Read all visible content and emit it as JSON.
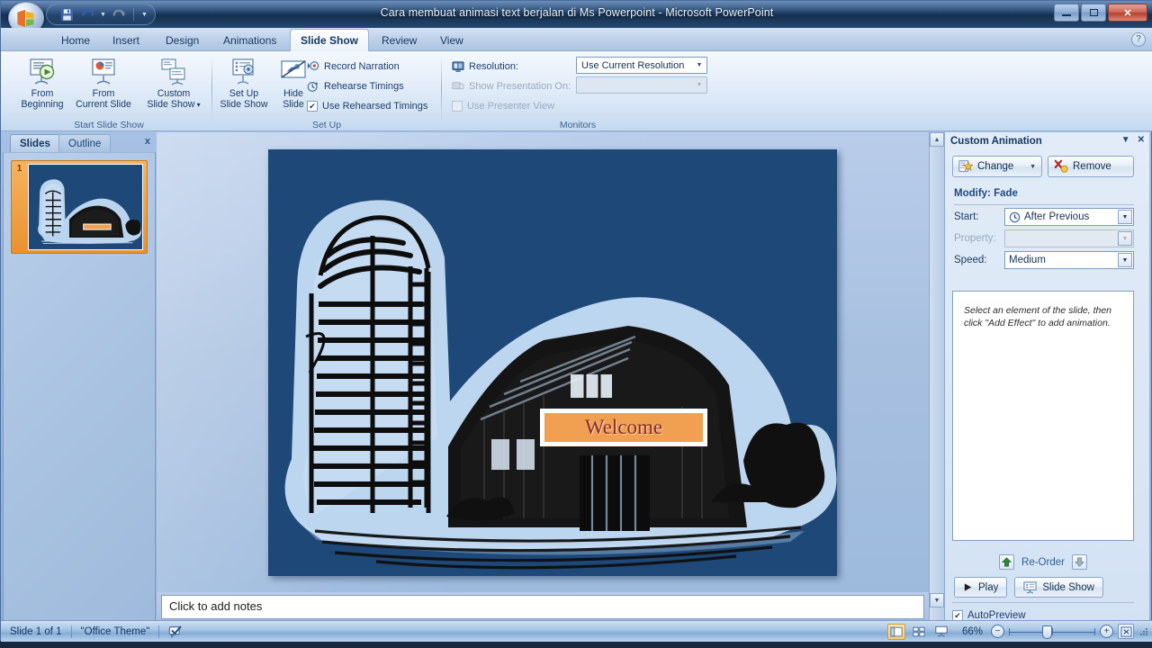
{
  "window": {
    "title": "Cara membuat animasi text berjalan di Ms Powerpoint - Microsoft PowerPoint",
    "minimize_label": "Minimize",
    "restore_label": "Restore Down",
    "close_label": "Close"
  },
  "quick_access": {
    "save_label": "Save",
    "undo_label": "Undo",
    "redo_label": "Redo",
    "customize_label": "Customize Quick Access Toolbar"
  },
  "ribbon": {
    "tabs": [
      {
        "label": "Home",
        "active": false
      },
      {
        "label": "Insert",
        "active": false
      },
      {
        "label": "Design",
        "active": false
      },
      {
        "label": "Animations",
        "active": false
      },
      {
        "label": "Slide Show",
        "active": true
      },
      {
        "label": "Review",
        "active": false
      },
      {
        "label": "View",
        "active": false
      }
    ],
    "help_label": "?",
    "groups": [
      {
        "name": "Start Slide Show",
        "label": "Start Slide Show"
      },
      {
        "name": "Set Up",
        "label": "Set Up"
      },
      {
        "name": "Monitors",
        "label": "Monitors"
      }
    ],
    "start_slide_show": {
      "from_beginning": {
        "line1": "From",
        "line2": "Beginning"
      },
      "from_current": {
        "line1": "From",
        "line2": "Current Slide"
      },
      "custom_slide_show": {
        "line1": "Custom",
        "line2": "Slide Show"
      }
    },
    "set_up": {
      "set_up_slide_show": {
        "line1": "Set Up",
        "line2": "Slide Show"
      },
      "hide_slide": {
        "line1": "Hide",
        "line2": "Slide"
      },
      "record_narration": "Record Narration",
      "rehearse_timings": "Rehearse Timings",
      "use_rehearsed_timings": "Use Rehearsed Timings",
      "use_rehearsed_checked": "✔"
    },
    "monitors": {
      "resolution_label": "Resolution:",
      "resolution_value": "Use Current Resolution",
      "show_presentation_label": "Show Presentation On:",
      "show_presentation_value": "",
      "use_presenter_view": "Use Presenter View"
    }
  },
  "left_pane": {
    "tab_slides": "Slides",
    "tab_outline": "Outline",
    "close_label": "x",
    "slide_number": "1"
  },
  "slide": {
    "background_color": "#1d4877",
    "artwork_name": "barn-and-silo-clipart",
    "textbox": {
      "text": "Welcome",
      "fill_color": "#f0a050",
      "text_color": "#8c2a2a",
      "border_color": "#ffffff"
    }
  },
  "notes": {
    "placeholder": "Click to add notes"
  },
  "task_pane": {
    "title": "Custom Animation",
    "dropdown_label": "▼",
    "close_label": "✕",
    "change_button": "Change",
    "change_caret": "▼",
    "remove_button": "Remove",
    "modify_heading": "Modify: Fade",
    "start_label": "Start:",
    "start_value": "After Previous",
    "property_label": "Property:",
    "property_value": "",
    "speed_label": "Speed:",
    "speed_value": "Medium",
    "list_hint": "Select an element of the slide, then click \"Add Effect\" to add animation.",
    "reorder_label": "Re-Order",
    "reorder_up": "▲",
    "reorder_down": "▼",
    "play_button": "Play",
    "slide_show_button": "Slide Show",
    "autopreview_label": "AutoPreview",
    "autopreview_checked": "✔"
  },
  "status_bar": {
    "slide_counter": "Slide 1 of 1",
    "theme": "\"Office Theme\"",
    "spellcheck_name": "spell-check-icon",
    "view_normal": "Normal View",
    "view_sorter": "Slide Sorter View",
    "view_show": "Slide Show View",
    "zoom_level": "66%",
    "zoom_out": "−",
    "zoom_in": "+",
    "fit_label": "Fit slide to current window"
  }
}
